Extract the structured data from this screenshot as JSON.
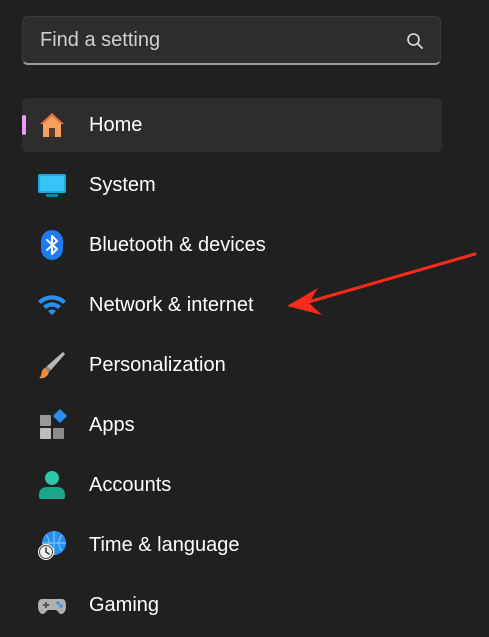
{
  "search": {
    "placeholder": "Find a setting",
    "icon": "search-icon"
  },
  "nav": {
    "items": [
      {
        "label": "Home",
        "icon": "home-icon",
        "selected": true
      },
      {
        "label": "System",
        "icon": "system-monitor-icon"
      },
      {
        "label": "Bluetooth & devices",
        "icon": "bluetooth-icon"
      },
      {
        "label": "Network & internet",
        "icon": "wifi-icon"
      },
      {
        "label": "Personalization",
        "icon": "paintbrush-icon"
      },
      {
        "label": "Apps",
        "icon": "apps-icon"
      },
      {
        "label": "Accounts",
        "icon": "accounts-person-icon"
      },
      {
        "label": "Time & language",
        "icon": "time-language-globe-icon"
      },
      {
        "label": "Gaming",
        "icon": "gamepad-icon"
      }
    ]
  },
  "colors": {
    "background": "#202020",
    "selected_indicator": "#e79df6",
    "annotation_arrow": "#ff2a1a"
  }
}
